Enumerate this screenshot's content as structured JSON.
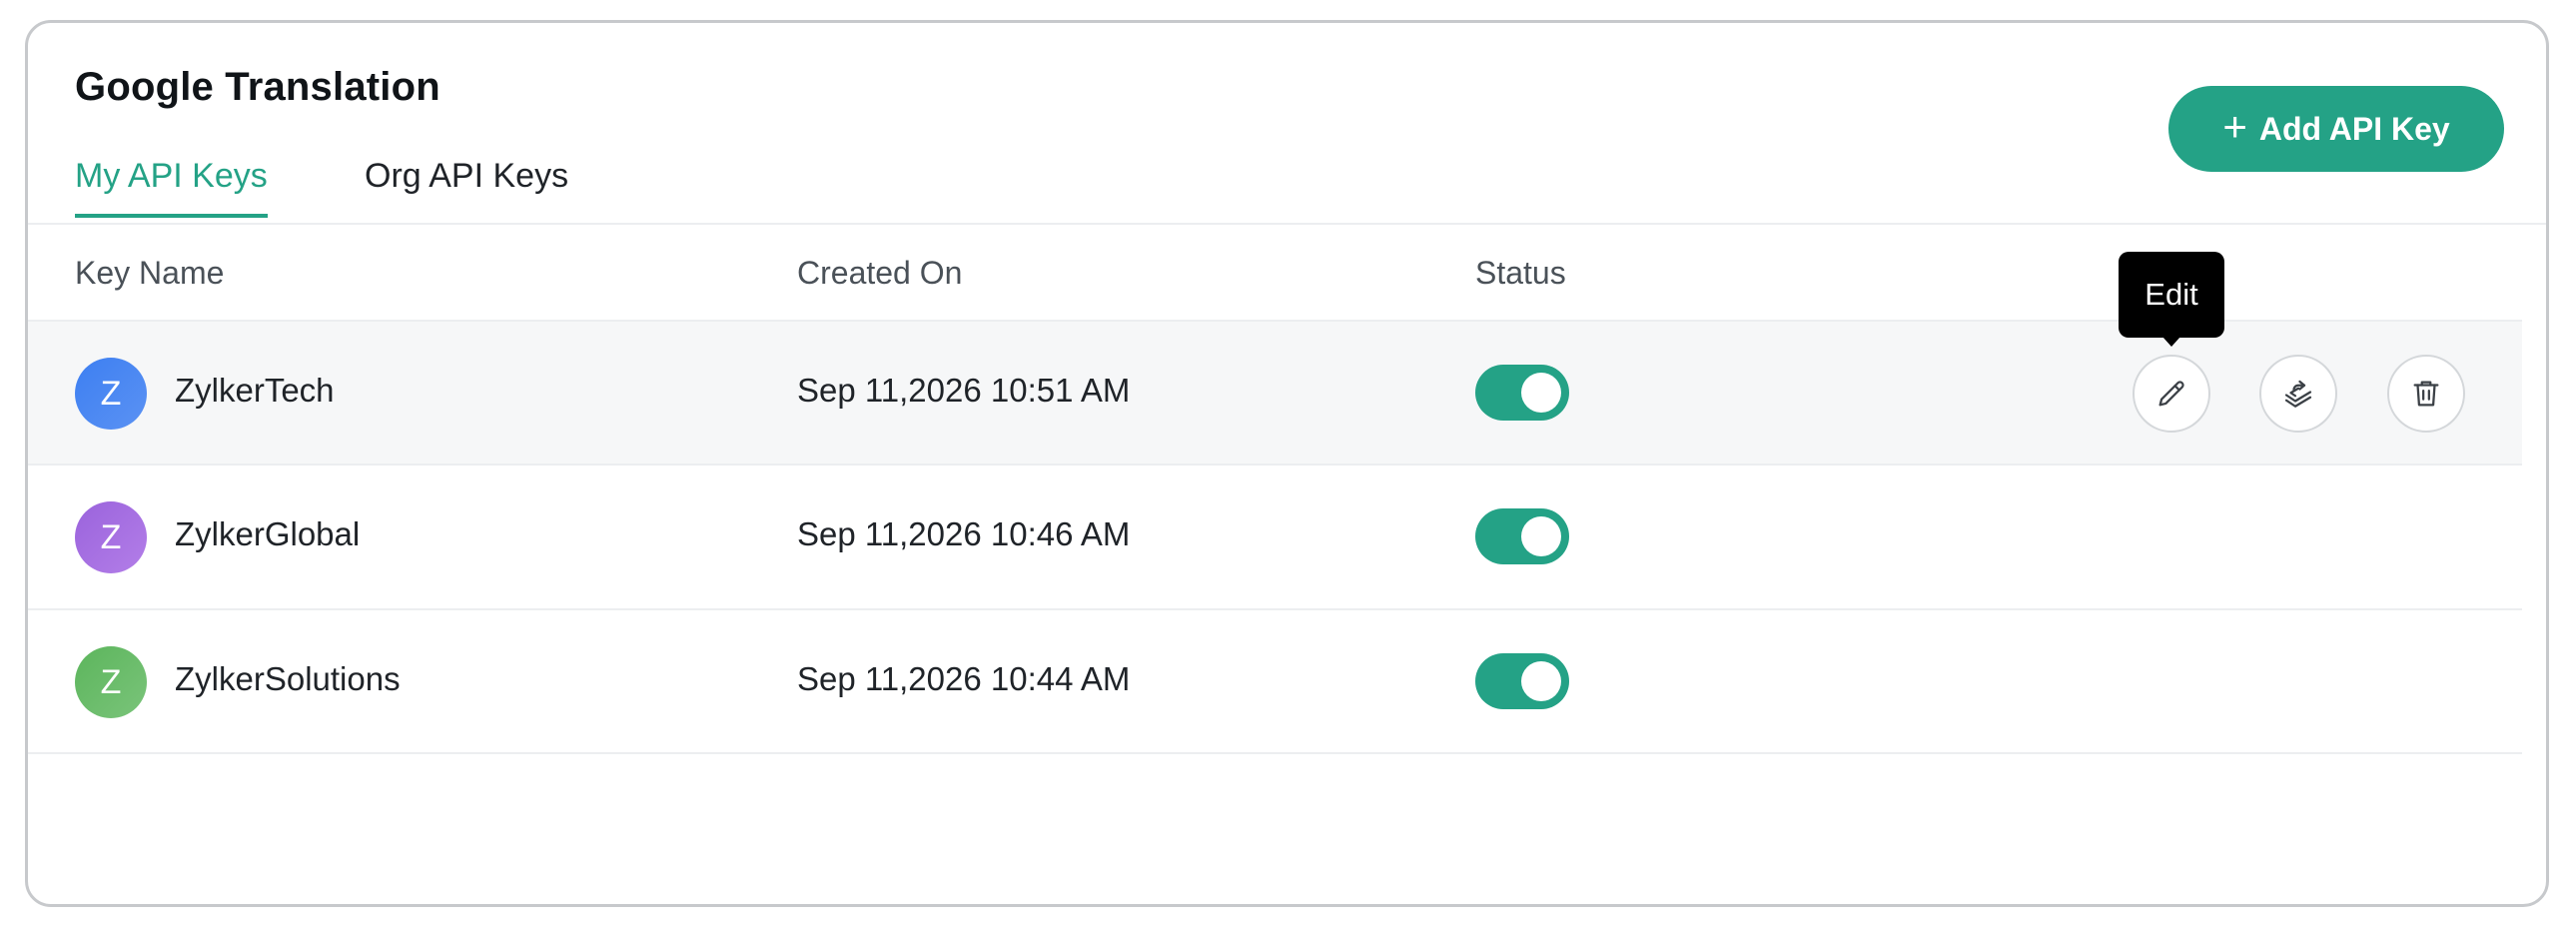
{
  "header": {
    "title": "Google Translation",
    "add_button_label": "Add API Key",
    "add_button_icon": "plus-icon"
  },
  "tabs": [
    {
      "label": "My API Keys",
      "active": true
    },
    {
      "label": "Org API Keys",
      "active": false
    }
  ],
  "table": {
    "columns": [
      "Key Name",
      "Created On",
      "Status"
    ],
    "rows": [
      {
        "avatar_letter": "Z",
        "avatar_color": "#3d7ff2",
        "name": "ZylkerTech",
        "created_on": "Sep 11,2026 10:51 AM",
        "status_enabled": true
      },
      {
        "avatar_letter": "Z",
        "avatar_color": "#9a63dc",
        "name": "ZylkerGlobal",
        "created_on": "Sep 11,2026 10:46 AM",
        "status_enabled": true
      },
      {
        "avatar_letter": "Z",
        "avatar_color": "#5cb55c",
        "name": "ZylkerSolutions",
        "created_on": "Sep 11,2026 10:44 AM",
        "status_enabled": true
      }
    ]
  },
  "row_actions": {
    "icons": [
      "pencil-icon",
      "regenerate-key-icon",
      "trash-icon"
    ]
  },
  "tooltip": {
    "text": "Edit"
  },
  "colors": {
    "accent": "#24a286",
    "border": "#c7c9cc",
    "hover_row": "#f6f7f8"
  }
}
